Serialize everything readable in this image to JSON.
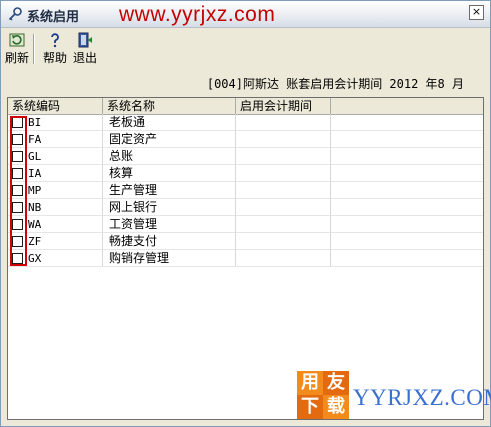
{
  "window": {
    "title": "系统启用",
    "watermark_url": "www.yyrjxz.com",
    "close_label": "×"
  },
  "toolbar": {
    "refresh_label": "刷新",
    "help_label": "帮助",
    "exit_label": "退出"
  },
  "period": "[004]阿斯达 账套启用会计期间 2012 年8 月",
  "table": {
    "headers": [
      "系统编码",
      "系统名称",
      "启用会计期间",
      ""
    ],
    "rows": [
      {
        "code": "BI",
        "name": "老板通",
        "period": ""
      },
      {
        "code": "FA",
        "name": "固定资产",
        "period": ""
      },
      {
        "code": "GL",
        "name": "总账",
        "period": ""
      },
      {
        "code": "IA",
        "name": "核算",
        "period": ""
      },
      {
        "code": "MP",
        "name": "生产管理",
        "period": ""
      },
      {
        "code": "NB",
        "name": "网上银行",
        "period": ""
      },
      {
        "code": "WA",
        "name": "工资管理",
        "period": ""
      },
      {
        "code": "ZF",
        "name": "畅捷支付",
        "period": ""
      },
      {
        "code": "GX",
        "name": "购销存管理",
        "period": ""
      }
    ]
  },
  "logo": {
    "chars": [
      "用",
      "友",
      "下",
      "载"
    ],
    "text": "YYRJXZ.COM"
  },
  "colors": {
    "accent_red": "#c40000",
    "highlight_box": "#d40000",
    "logo_orange": "#f28a1c",
    "logo_blue": "#3a6fd0"
  }
}
